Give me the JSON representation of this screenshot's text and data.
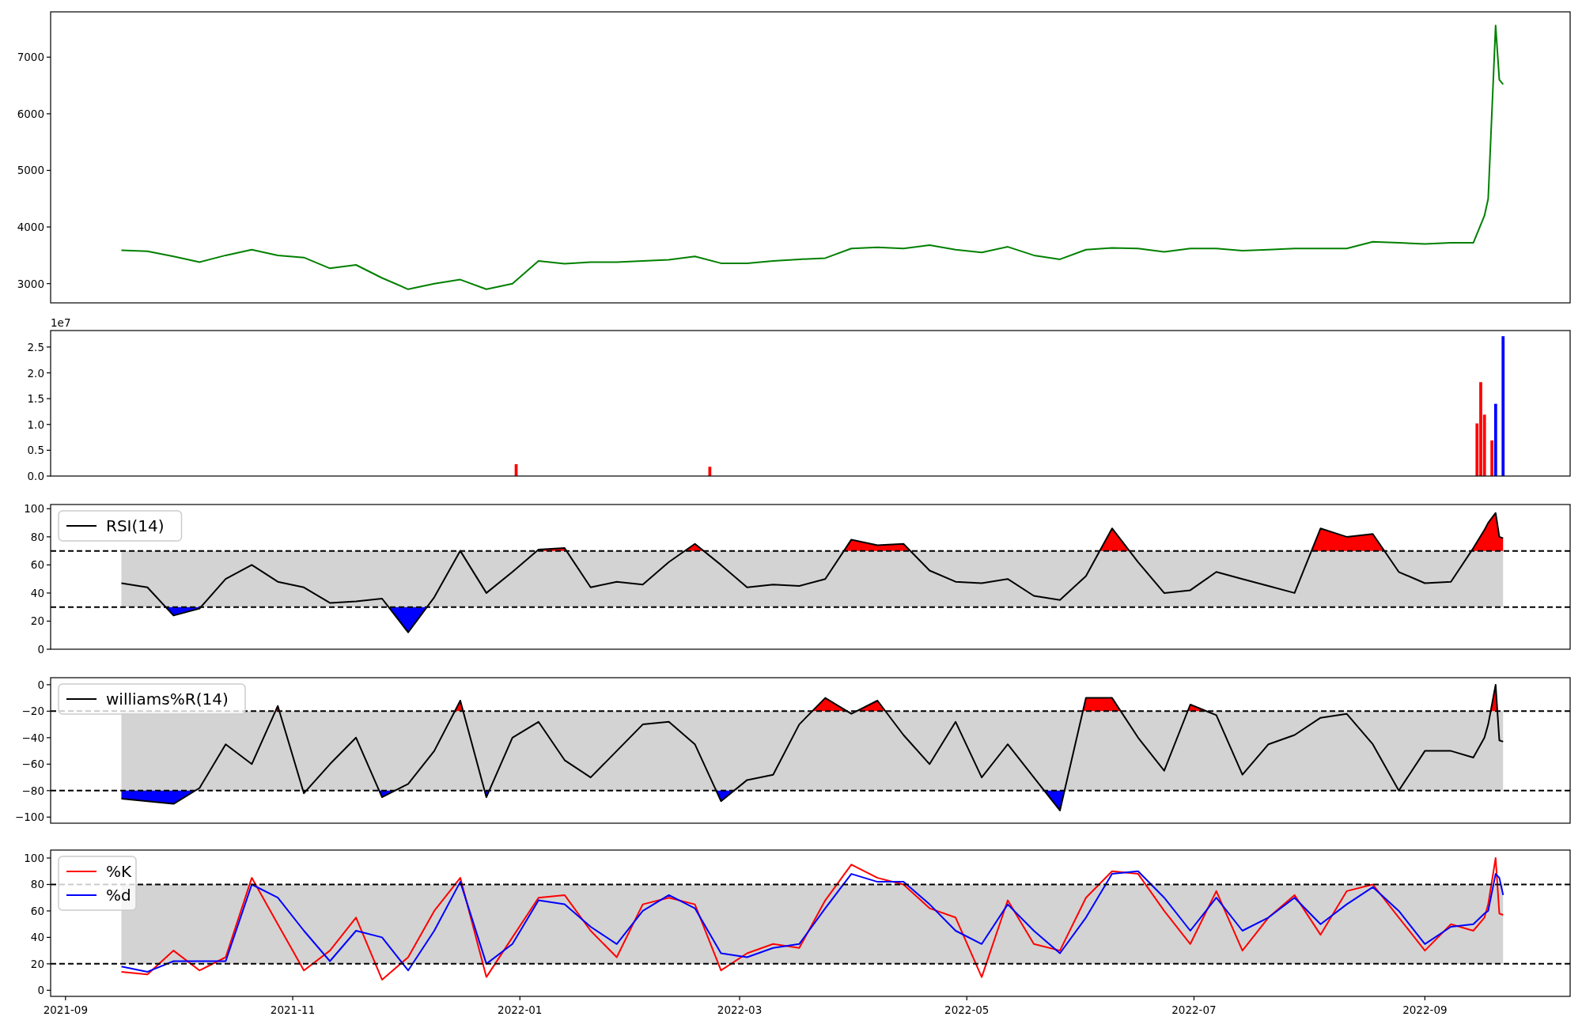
{
  "panels": [
    {
      "chart_data": {
        "type": "line",
        "x": [
          "2021-09-16",
          "2021-09-23",
          "2021-09-30",
          "2021-10-07",
          "2021-10-14",
          "2021-10-21",
          "2021-10-28",
          "2021-11-04",
          "2021-11-11",
          "2021-11-18",
          "2021-11-25",
          "2021-12-02",
          "2021-12-09",
          "2021-12-16",
          "2021-12-23",
          "2021-12-30",
          "2022-01-06",
          "2022-01-13",
          "2022-01-20",
          "2022-01-27",
          "2022-02-03",
          "2022-02-10",
          "2022-02-17",
          "2022-02-24",
          "2022-03-03",
          "2022-03-10",
          "2022-03-17",
          "2022-03-24",
          "2022-03-31",
          "2022-04-07",
          "2022-04-14",
          "2022-04-21",
          "2022-04-28",
          "2022-05-05",
          "2022-05-12",
          "2022-05-19",
          "2022-05-26",
          "2022-06-02",
          "2022-06-09",
          "2022-06-16",
          "2022-06-23",
          "2022-06-30",
          "2022-07-07",
          "2022-07-14",
          "2022-07-21",
          "2022-07-28",
          "2022-08-04",
          "2022-08-11",
          "2022-08-18",
          "2022-08-25",
          "2022-09-01",
          "2022-09-08",
          "2022-09-14",
          "2022-09-17",
          "2022-09-18",
          "2022-09-20",
          "2022-09-21",
          "2022-09-22"
        ],
        "xlim": [
          "2021-08-28",
          "2022-10-10"
        ],
        "ylim": [
          2660,
          7800
        ],
        "yticks": [
          3000,
          4000,
          5000,
          6000,
          7000
        ],
        "series": [
          {
            "color": "#008000",
            "values": [
              3590,
              3570,
              3480,
              3380,
              3500,
              3600,
              3500,
              3460,
              3270,
              3330,
              3100,
              2900,
              3000,
              3070,
              2900,
              3000,
              3400,
              3350,
              3380,
              3380,
              3400,
              3420,
              3480,
              3360,
              3360,
              3400,
              3430,
              3450,
              3620,
              3640,
              3620,
              3680,
              3600,
              3550,
              3650,
              3500,
              3430,
              3600,
              3630,
              3620,
              3560,
              3620,
              3620,
              3580,
              3600,
              3620,
              3620,
              3620,
              3740,
              3720,
              3700,
              3720,
              3720,
              4200,
              4500,
              7560,
              6600,
              6520
            ]
          }
        ]
      }
    },
    {
      "offset_label": "1e7",
      "chart_data": {
        "type": "bar",
        "x": [
          "2021-12-31",
          "2022-02-21",
          "2022-09-15",
          "2022-09-16",
          "2022-09-17",
          "2022-09-19",
          "2022-09-20",
          "2022-09-22"
        ],
        "xlim": [
          "2021-08-28",
          "2022-10-10"
        ],
        "ylim": [
          0,
          2.82
        ],
        "yticks": [
          {
            "value": 0,
            "label": "0.0"
          },
          {
            "value": 0.5,
            "label": "0.5"
          },
          {
            "value": 1,
            "label": "1.0"
          },
          {
            "value": 1.5,
            "label": "1.5"
          },
          {
            "value": 2,
            "label": "2.0"
          },
          {
            "value": 2.5,
            "label": "2.5"
          }
        ],
        "series": [
          {
            "color": "#ff0000",
            "values": [
              0.23,
              0.18,
              1.02,
              1.82,
              1.19,
              0.69,
              null,
              null
            ]
          },
          {
            "color": "#0000ff",
            "values": [
              null,
              null,
              null,
              null,
              null,
              null,
              1.4,
              2.71
            ]
          }
        ]
      }
    },
    {
      "extreme_fill": true,
      "chart_data": {
        "type": "line",
        "x": [
          "2021-09-16",
          "2021-09-23",
          "2021-09-30",
          "2021-10-07",
          "2021-10-14",
          "2021-10-21",
          "2021-10-28",
          "2021-11-04",
          "2021-11-11",
          "2021-11-18",
          "2021-11-25",
          "2021-12-02",
          "2021-12-09",
          "2021-12-16",
          "2021-12-23",
          "2021-12-30",
          "2022-01-06",
          "2022-01-13",
          "2022-01-20",
          "2022-01-27",
          "2022-02-03",
          "2022-02-10",
          "2022-02-17",
          "2022-02-24",
          "2022-03-03",
          "2022-03-10",
          "2022-03-17",
          "2022-03-24",
          "2022-03-31",
          "2022-04-07",
          "2022-04-14",
          "2022-04-21",
          "2022-04-28",
          "2022-05-05",
          "2022-05-12",
          "2022-05-19",
          "2022-05-26",
          "2022-06-02",
          "2022-06-09",
          "2022-06-16",
          "2022-06-23",
          "2022-06-30",
          "2022-07-07",
          "2022-07-14",
          "2022-07-21",
          "2022-07-28",
          "2022-08-04",
          "2022-08-11",
          "2022-08-18",
          "2022-08-25",
          "2022-09-01",
          "2022-09-08",
          "2022-09-14",
          "2022-09-17",
          "2022-09-18",
          "2022-09-20",
          "2022-09-21",
          "2022-09-22"
        ],
        "xlim": [
          "2021-08-28",
          "2022-10-10"
        ],
        "ylim": [
          0,
          103
        ],
        "yticks": [
          0,
          20,
          40,
          60,
          80,
          100
        ],
        "ref_lines": [
          {
            "axis": "y",
            "value": 70
          },
          {
            "axis": "y",
            "value": 30
          }
        ],
        "bands": [
          {
            "axis": "y",
            "from": 30,
            "to": 70
          }
        ],
        "legend": true,
        "series": [
          {
            "name": "RSI(14)",
            "color": "#000000",
            "values": [
              47,
              44,
              24,
              29,
              50,
              60,
              48,
              44,
              33,
              34,
              36,
              12,
              37,
              70,
              40,
              55,
              71,
              72,
              44,
              48,
              46,
              62,
              75,
              60,
              44,
              46,
              45,
              50,
              78,
              74,
              75,
              56,
              48,
              47,
              50,
              38,
              35,
              52,
              86,
              62,
              40,
              42,
              55,
              50,
              45,
              40,
              86,
              80,
              82,
              55,
              47,
              48,
              72,
              85,
              90,
              97,
              80,
              79
            ]
          }
        ]
      }
    },
    {
      "extreme_fill": true,
      "chart_data": {
        "type": "line",
        "x": [
          "2021-09-16",
          "2021-09-23",
          "2021-09-30",
          "2021-10-07",
          "2021-10-14",
          "2021-10-21",
          "2021-10-28",
          "2021-11-04",
          "2021-11-11",
          "2021-11-18",
          "2021-11-25",
          "2021-12-02",
          "2021-12-09",
          "2021-12-16",
          "2021-12-23",
          "2021-12-30",
          "2022-01-06",
          "2022-01-13",
          "2022-01-20",
          "2022-01-27",
          "2022-02-03",
          "2022-02-10",
          "2022-02-17",
          "2022-02-24",
          "2022-03-03",
          "2022-03-10",
          "2022-03-17",
          "2022-03-24",
          "2022-03-31",
          "2022-04-07",
          "2022-04-14",
          "2022-04-21",
          "2022-04-28",
          "2022-05-05",
          "2022-05-12",
          "2022-05-19",
          "2022-05-26",
          "2022-06-02",
          "2022-06-09",
          "2022-06-16",
          "2022-06-23",
          "2022-06-30",
          "2022-07-07",
          "2022-07-14",
          "2022-07-21",
          "2022-07-28",
          "2022-08-04",
          "2022-08-11",
          "2022-08-18",
          "2022-08-25",
          "2022-09-01",
          "2022-09-08",
          "2022-09-14",
          "2022-09-17",
          "2022-09-18",
          "2022-09-20",
          "2022-09-21",
          "2022-09-22"
        ],
        "xlim": [
          "2021-08-28",
          "2022-10-10"
        ],
        "ylim": [
          -104.6,
          5.3
        ],
        "yticks": [
          {
            "value": -100,
            "label": "−100"
          },
          {
            "value": -80,
            "label": "−80"
          },
          {
            "value": -60,
            "label": "−60"
          },
          {
            "value": -40,
            "label": "−40"
          },
          {
            "value": -20,
            "label": "−20"
          },
          {
            "value": 0,
            "label": "0"
          }
        ],
        "ref_lines": [
          {
            "axis": "y",
            "value": -20
          },
          {
            "axis": "y",
            "value": -80
          }
        ],
        "bands": [
          {
            "axis": "y",
            "from": -80,
            "to": -20
          }
        ],
        "legend": true,
        "series": [
          {
            "name": "williams%R(14)",
            "color": "#000000",
            "values": [
              -86,
              -88,
              -90,
              -78,
              -45,
              -60,
              -16,
              -82,
              -60,
              -40,
              -85,
              -75,
              -50,
              -12,
              -85,
              -40,
              -28,
              -57,
              -70,
              -50,
              -30,
              -28,
              -45,
              -88,
              -72,
              -68,
              -30,
              -10,
              -22,
              -12,
              -38,
              -60,
              -28,
              -70,
              -45,
              -70,
              -95,
              -10,
              -10,
              -40,
              -65,
              -15,
              -23,
              -68,
              -45,
              -38,
              -25,
              -22,
              -45,
              -80,
              -50,
              -50,
              -55,
              -40,
              -30,
              0,
              -42,
              -43
            ]
          }
        ]
      }
    },
    {
      "chart_data": {
        "type": "line",
        "x": [
          "2021-09-16",
          "2021-09-23",
          "2021-09-30",
          "2021-10-07",
          "2021-10-14",
          "2021-10-21",
          "2021-10-28",
          "2021-11-04",
          "2021-11-11",
          "2021-11-18",
          "2021-11-25",
          "2021-12-02",
          "2021-12-09",
          "2021-12-16",
          "2021-12-23",
          "2021-12-30",
          "2022-01-06",
          "2022-01-13",
          "2022-01-20",
          "2022-01-27",
          "2022-02-03",
          "2022-02-10",
          "2022-02-17",
          "2022-02-24",
          "2022-03-03",
          "2022-03-10",
          "2022-03-17",
          "2022-03-24",
          "2022-03-31",
          "2022-04-07",
          "2022-04-14",
          "2022-04-21",
          "2022-04-28",
          "2022-05-05",
          "2022-05-12",
          "2022-05-19",
          "2022-05-26",
          "2022-06-02",
          "2022-06-09",
          "2022-06-16",
          "2022-06-23",
          "2022-06-30",
          "2022-07-07",
          "2022-07-14",
          "2022-07-21",
          "2022-07-28",
          "2022-08-04",
          "2022-08-11",
          "2022-08-18",
          "2022-08-25",
          "2022-09-01",
          "2022-09-08",
          "2022-09-14",
          "2022-09-17",
          "2022-09-18",
          "2022-09-20",
          "2022-09-21",
          "2022-09-22"
        ],
        "xlim": [
          "2021-08-28",
          "2022-10-10"
        ],
        "ylim": [
          -4.6,
          106
        ],
        "yticks": [
          0,
          20,
          40,
          60,
          80,
          100
        ],
        "xticks": [
          {
            "value": "2021-09-01",
            "label": "2021-09"
          },
          {
            "value": "2021-11-01",
            "label": "2021-11"
          },
          {
            "value": "2022-01-01",
            "label": "2022-01"
          },
          {
            "value": "2022-03-01",
            "label": "2022-03"
          },
          {
            "value": "2022-05-01",
            "label": "2022-05"
          },
          {
            "value": "2022-07-01",
            "label": "2022-07"
          },
          {
            "value": "2022-09-01",
            "label": "2022-09"
          }
        ],
        "ref_lines": [
          {
            "axis": "y",
            "value": 80
          },
          {
            "axis": "y",
            "value": 20
          }
        ],
        "bands": [
          {
            "axis": "y",
            "from": 20,
            "to": 80
          }
        ],
        "legend": true,
        "series": [
          {
            "name": "%K",
            "color": "#ff0000",
            "values": [
              14,
              12,
              30,
              15,
              25,
              85,
              50,
              15,
              30,
              55,
              8,
              25,
              60,
              85,
              10,
              40,
              70,
              72,
              45,
              25,
              65,
              70,
              65,
              15,
              28,
              35,
              32,
              68,
              95,
              85,
              80,
              62,
              55,
              10,
              68,
              35,
              30,
              70,
              90,
              88,
              60,
              35,
              75,
              30,
              55,
              72,
              42,
              75,
              80,
              55,
              30,
              50,
              45,
              55,
              65,
              100,
              58,
              57
            ]
          },
          {
            "name": "%d",
            "color": "#0000ff",
            "values": [
              18,
              14,
              22,
              22,
              22,
              80,
              70,
              45,
              22,
              45,
              40,
              15,
              45,
              82,
              20,
              35,
              68,
              65,
              48,
              35,
              60,
              72,
              62,
              28,
              25,
              32,
              35,
              62,
              88,
              82,
              82,
              65,
              45,
              35,
              65,
              45,
              28,
              55,
              88,
              90,
              70,
              45,
              70,
              45,
              55,
              70,
              50,
              65,
              78,
              60,
              35,
              48,
              50,
              58,
              60,
              88,
              85,
              72
            ]
          }
        ]
      }
    }
  ]
}
